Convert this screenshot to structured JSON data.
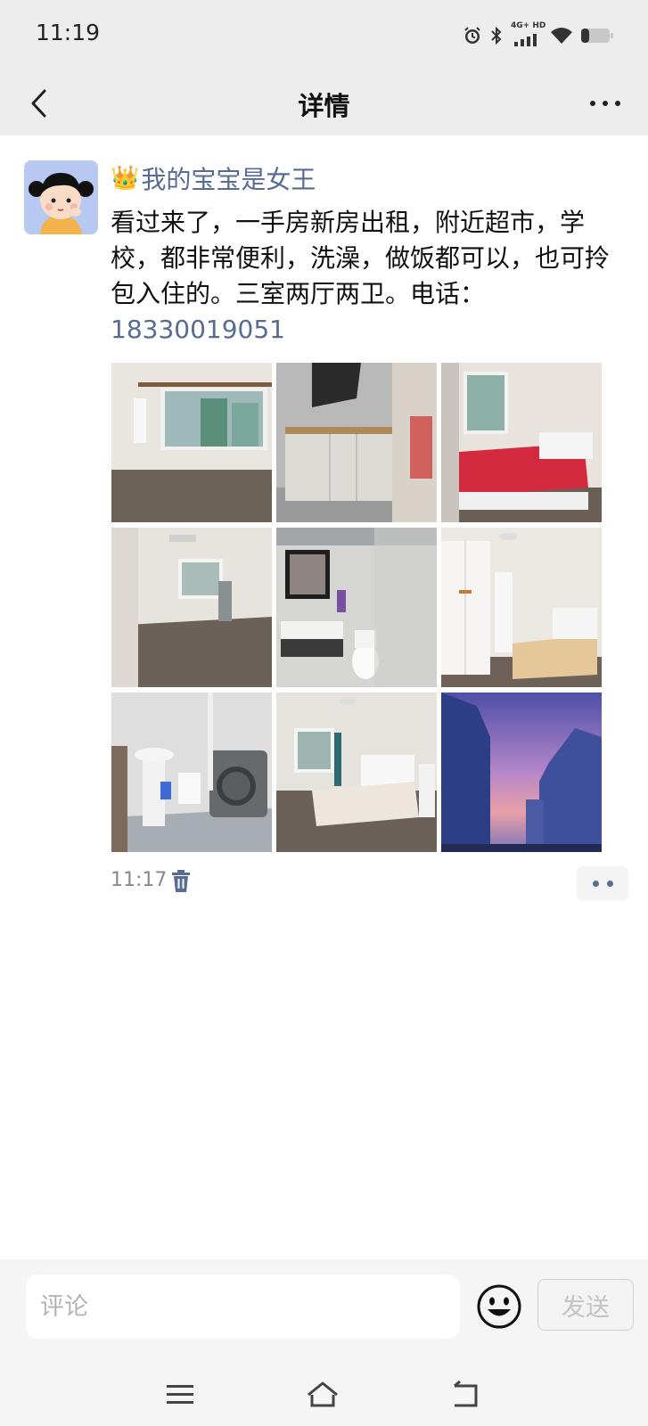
{
  "status_bar": {
    "time": "11:19",
    "network": "4G+ HD",
    "icons": [
      "alarm-icon",
      "bluetooth-icon",
      "signal-icon",
      "wifi-icon",
      "battery-icon"
    ]
  },
  "nav": {
    "title": "详情",
    "back_icon": "chevron-left-icon",
    "more_icon": "more-icon"
  },
  "post": {
    "author_emoji": "👑",
    "author_name": "我的宝宝是女王",
    "text": "看过来了，一手房新房出租，附近超市，学校，都非常便利，洗澡，做饭都可以，也可拎包入住的。三室两厅两卫。电话：",
    "phone": "18330019051",
    "photos": [
      {
        "name": "room-window-photo"
      },
      {
        "name": "kitchen-photo"
      },
      {
        "name": "bedroom-red-bed-photo"
      },
      {
        "name": "living-room-photo"
      },
      {
        "name": "bathroom-sink-photo"
      },
      {
        "name": "bedroom-wardrobe-photo"
      },
      {
        "name": "bathroom-washer-photo"
      },
      {
        "name": "bedroom-white-bed-photo"
      },
      {
        "name": "sunset-buildings-photo"
      }
    ],
    "time": "11:17"
  },
  "comment": {
    "placeholder": "评论",
    "send_label": "发送"
  },
  "colors": {
    "link": "#576b95",
    "bar_bg": "#ededed"
  }
}
